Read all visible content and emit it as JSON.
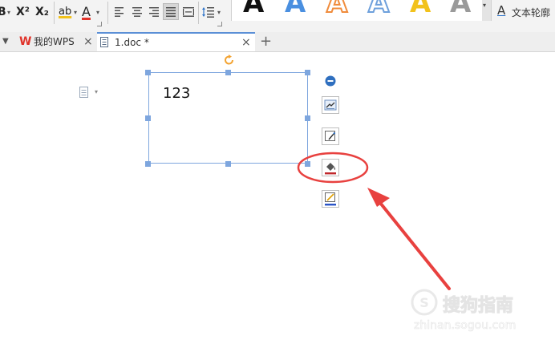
{
  "toolbar": {
    "fmt_b": "B",
    "superscript": "X²",
    "subscript": "X₂",
    "highlight": "ab",
    "font_color": "A",
    "text_outline_label": "文本轮廓",
    "word_art_letter": "A"
  },
  "tabs": {
    "home_tab": "我的WPS",
    "doc_tab": "1.doc *",
    "close": "×",
    "new_tab": "+"
  },
  "document": {
    "textbox_text": "123"
  },
  "watermark": {
    "brand": "搜狗指南",
    "url": "zhinan.sogou.com"
  },
  "colors": {
    "annotation_red": "#e8413f",
    "handle_blue": "#7ea6de",
    "wps_red": "#e0332a",
    "accent_blue": "#4a8fe0",
    "orange": "#f08c3c",
    "yellow": "#f2c21c"
  }
}
